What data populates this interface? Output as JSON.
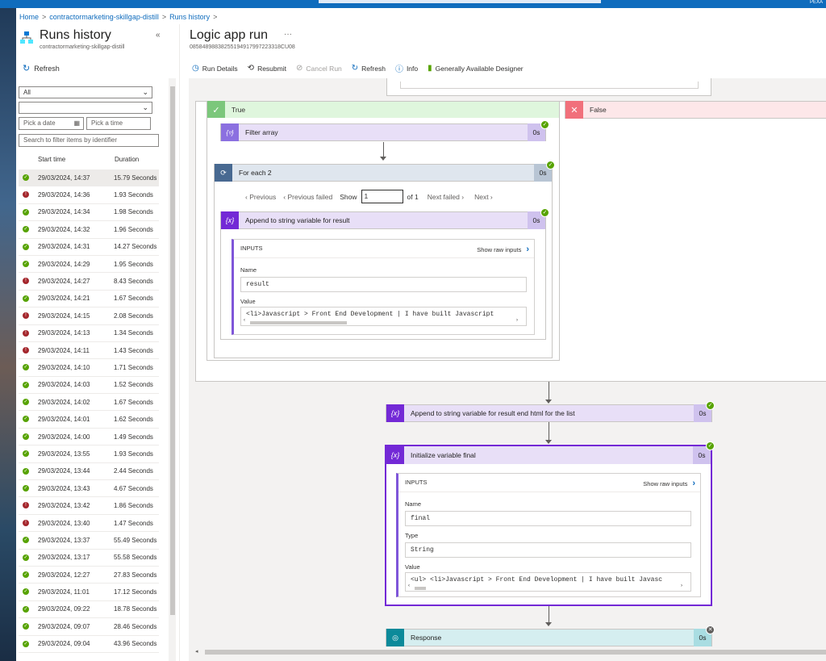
{
  "topbar": {
    "user_text": "PEXA"
  },
  "breadcrumb": [
    "Home",
    "contractormarketing-skillgap-distill",
    "Runs history"
  ],
  "left_panel": {
    "title": "Runs history",
    "subtitle": "contractormarketing-skillgap-distill",
    "collapse": "«",
    "refresh": "Refresh",
    "status_filter": "All",
    "second_filter": "",
    "date_placeholder": "Pick a date",
    "time_placeholder": "Pick a time",
    "id_filter_placeholder": "Search to filter items by identifier",
    "col_start": "Start time",
    "col_duration": "Duration",
    "runs": [
      {
        "status": "success",
        "time": "29/03/2024, 14:37",
        "duration": "15.79 Seconds"
      },
      {
        "status": "failed",
        "time": "29/03/2024, 14:36",
        "duration": "1.93 Seconds"
      },
      {
        "status": "success",
        "time": "29/03/2024, 14:34",
        "duration": "1.98 Seconds"
      },
      {
        "status": "success",
        "time": "29/03/2024, 14:32",
        "duration": "1.96 Seconds"
      },
      {
        "status": "success",
        "time": "29/03/2024, 14:31",
        "duration": "14.27 Seconds"
      },
      {
        "status": "success",
        "time": "29/03/2024, 14:29",
        "duration": "1.95 Seconds"
      },
      {
        "status": "failed",
        "time": "29/03/2024, 14:27",
        "duration": "8.43 Seconds"
      },
      {
        "status": "success",
        "time": "29/03/2024, 14:21",
        "duration": "1.67 Seconds"
      },
      {
        "status": "failed",
        "time": "29/03/2024, 14:15",
        "duration": "2.08 Seconds"
      },
      {
        "status": "failed",
        "time": "29/03/2024, 14:13",
        "duration": "1.34 Seconds"
      },
      {
        "status": "failed",
        "time": "29/03/2024, 14:11",
        "duration": "1.43 Seconds"
      },
      {
        "status": "success",
        "time": "29/03/2024, 14:10",
        "duration": "1.71 Seconds"
      },
      {
        "status": "success",
        "time": "29/03/2024, 14:03",
        "duration": "1.52 Seconds"
      },
      {
        "status": "success",
        "time": "29/03/2024, 14:02",
        "duration": "1.67 Seconds"
      },
      {
        "status": "success",
        "time": "29/03/2024, 14:01",
        "duration": "1.62 Seconds"
      },
      {
        "status": "success",
        "time": "29/03/2024, 14:00",
        "duration": "1.49 Seconds"
      },
      {
        "status": "success",
        "time": "29/03/2024, 13:55",
        "duration": "1.93 Seconds"
      },
      {
        "status": "success",
        "time": "29/03/2024, 13:44",
        "duration": "2.44 Seconds"
      },
      {
        "status": "success",
        "time": "29/03/2024, 13:43",
        "duration": "4.67 Seconds"
      },
      {
        "status": "failed",
        "time": "29/03/2024, 13:42",
        "duration": "1.86 Seconds"
      },
      {
        "status": "failed",
        "time": "29/03/2024, 13:40",
        "duration": "1.47 Seconds"
      },
      {
        "status": "success",
        "time": "29/03/2024, 13:37",
        "duration": "55.49 Seconds"
      },
      {
        "status": "success",
        "time": "29/03/2024, 13:17",
        "duration": "55.58 Seconds"
      },
      {
        "status": "success",
        "time": "29/03/2024, 12:27",
        "duration": "27.83 Seconds"
      },
      {
        "status": "success",
        "time": "29/03/2024, 11:01",
        "duration": "17.12 Seconds"
      },
      {
        "status": "success",
        "time": "29/03/2024, 09:22",
        "duration": "18.78 Seconds"
      },
      {
        "status": "success",
        "time": "29/03/2024, 09:07",
        "duration": "28.46 Seconds"
      },
      {
        "status": "success",
        "time": "29/03/2024, 09:04",
        "duration": "43.96 Seconds"
      }
    ]
  },
  "main": {
    "title": "Logic app run",
    "more": "···",
    "run_id": "08584898838255194917997223318CU08",
    "toolbar": {
      "run_details": "Run Details",
      "resubmit": "Resubmit",
      "cancel_run": "Cancel Run",
      "refresh": "Refresh",
      "info": "Info",
      "designer": "Generally Available Designer"
    }
  },
  "canvas": {
    "true_label": "True",
    "false_label": "False",
    "filter_array": {
      "title": "Filter array",
      "duration": "0s"
    },
    "for_each": {
      "title": "For each 2",
      "duration": "0s",
      "previous": "Previous",
      "previous_failed": "Previous failed",
      "show": "Show",
      "page": "1",
      "of": "of 1",
      "next_failed": "Next failed",
      "next": "Next"
    },
    "append_result": {
      "title": "Append to string variable for result",
      "duration": "0s",
      "inputs": "INPUTS",
      "show_raw": "Show raw inputs",
      "name_label": "Name",
      "name_value": "result",
      "value_label": "Value",
      "value_text": "<li>Javascript > Front End Development | I have built Javascript"
    },
    "append_end": {
      "title": "Append to string variable for result end html for the list",
      "duration": "0s"
    },
    "init_final": {
      "title": "Initialize variable final",
      "duration": "0s",
      "inputs": "INPUTS",
      "show_raw": "Show raw inputs",
      "name_label": "Name",
      "name_value": "final",
      "type_label": "Type",
      "type_value": "String",
      "value_label": "Value",
      "value_text": "<ul> <li>Javascript > Front End Development | I have built Javasc"
    },
    "response": {
      "title": "Response",
      "duration": "0s"
    }
  }
}
